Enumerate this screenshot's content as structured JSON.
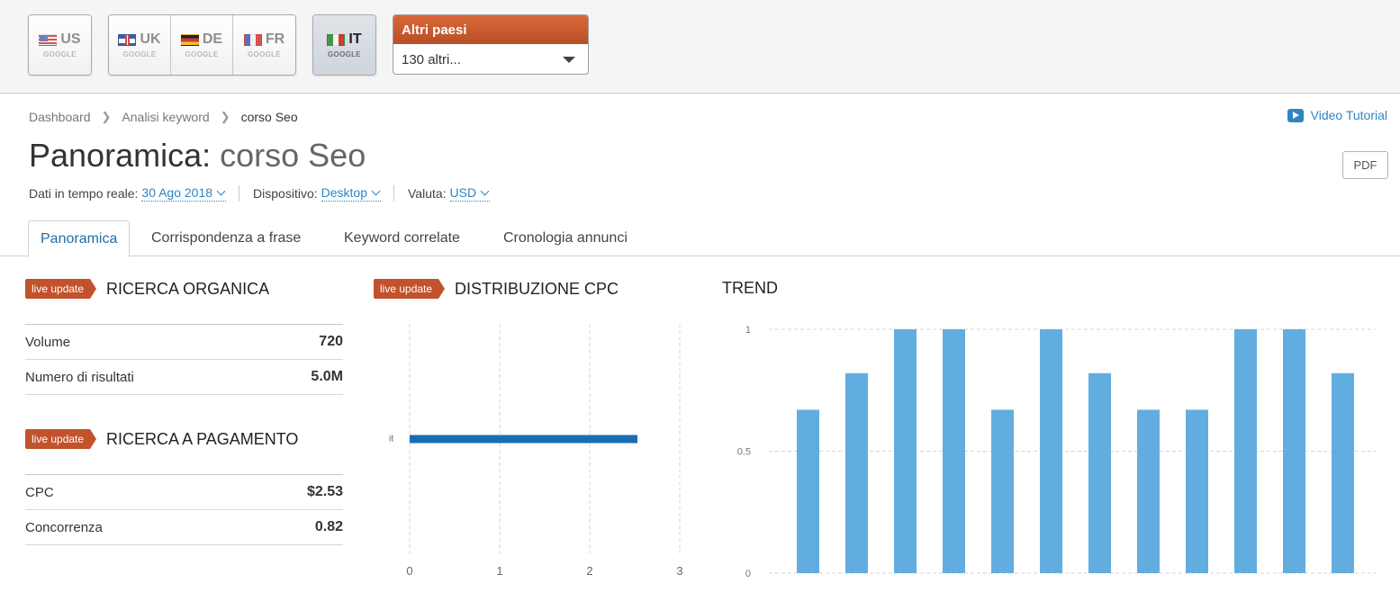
{
  "databases": {
    "groups": [
      [
        {
          "code": "US",
          "engine": "GOOGLE",
          "flag": "us",
          "active": false
        }
      ],
      [
        {
          "code": "UK",
          "engine": "GOOGLE",
          "flag": "uk",
          "active": false
        },
        {
          "code": "DE",
          "engine": "GOOGLE",
          "flag": "de",
          "active": false
        },
        {
          "code": "FR",
          "engine": "GOOGLE",
          "flag": "fr",
          "active": false
        }
      ],
      [
        {
          "code": "IT",
          "engine": "GOOGLE",
          "flag": "it",
          "active": true
        }
      ]
    ],
    "other": {
      "header": "Altri paesi",
      "selected": "130 altri..."
    }
  },
  "breadcrumb": [
    "Dashboard",
    "Analisi keyword",
    "corso Seo"
  ],
  "video_tutorial": "Video Tutorial",
  "pdf_label": "PDF",
  "page_title": {
    "prefix": "Panoramica:",
    "keyword": "corso Seo"
  },
  "filters": [
    {
      "label": "Dati in tempo reale:",
      "value": "30 Ago 2018"
    },
    {
      "label": "Dispositivo:",
      "value": "Desktop"
    },
    {
      "label": "Valuta:",
      "value": "USD"
    }
  ],
  "tabs": [
    {
      "label": "Panoramica",
      "active": true
    },
    {
      "label": "Corrispondenza a frase",
      "active": false
    },
    {
      "label": "Keyword correlate",
      "active": false
    },
    {
      "label": "Cronologia annunci",
      "active": false
    }
  ],
  "badge": "live update",
  "organic": {
    "title": "RICERCA ORGANICA",
    "rows": [
      {
        "label": "Volume",
        "value": "720"
      },
      {
        "label": "Numero di risultati",
        "value": "5.0M"
      }
    ]
  },
  "paid": {
    "title": "RICERCA A PAGAMENTO",
    "rows": [
      {
        "label": "CPC",
        "value": "$2.53"
      },
      {
        "label": "Concorrenza",
        "value": "0.82"
      }
    ]
  },
  "cpc_title": "DISTRIBUZIONE CPC",
  "trend_title": "TREND",
  "colors": {
    "cpc_bar": "#1a6db5",
    "trend_bar": "#62ade0",
    "badge": "#c1522b"
  },
  "chart_data": [
    {
      "type": "bar",
      "orientation": "horizontal",
      "categories": [
        "it"
      ],
      "values": [
        2.53
      ],
      "xlim": [
        0,
        3
      ],
      "xticks": [
        "0",
        "1",
        "2",
        "3"
      ],
      "grid": true
    },
    {
      "type": "bar",
      "values": [
        0.67,
        0.82,
        1,
        1,
        0.67,
        1,
        0.82,
        0.67,
        0.67,
        1,
        1,
        0.82
      ],
      "ylim": [
        0,
        1
      ],
      "yticks": [
        "0",
        "0.5",
        "1"
      ],
      "grid": true
    }
  ]
}
